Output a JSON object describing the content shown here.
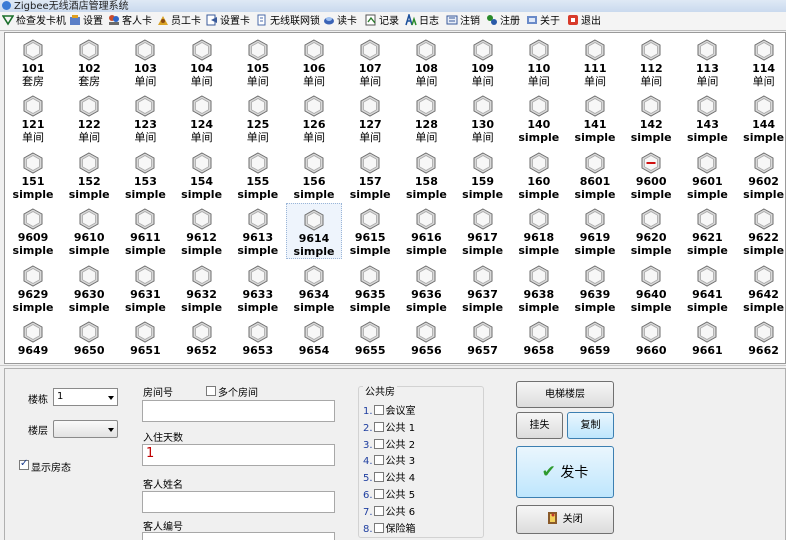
{
  "window": {
    "title": "Zigbee无线酒店管理系统"
  },
  "toolbar": {
    "items": [
      {
        "label": "检查发卡机",
        "icon": "card-check-icon"
      },
      {
        "label": "设置",
        "icon": "settings-icon"
      },
      {
        "label": "客人卡",
        "icon": "guest-card-icon"
      },
      {
        "label": "员工卡",
        "icon": "staff-card-icon"
      },
      {
        "label": "设置卡",
        "icon": "setting-card-icon"
      },
      {
        "label": "无线联网锁",
        "icon": "wireless-lock-icon"
      },
      {
        "label": "读卡",
        "icon": "read-card-icon"
      },
      {
        "label": "记录",
        "icon": "record-icon"
      },
      {
        "label": "日志",
        "icon": "log-icon"
      },
      {
        "label": "注销",
        "icon": "cancel-card-icon"
      },
      {
        "label": "注册",
        "icon": "register-icon"
      },
      {
        "label": "关于",
        "icon": "about-icon"
      },
      {
        "label": "退出",
        "icon": "exit-icon"
      }
    ]
  },
  "rooms": [
    {
      "num": "101",
      "type": "套房"
    },
    {
      "num": "102",
      "type": "套房"
    },
    {
      "num": "103",
      "type": "单间"
    },
    {
      "num": "104",
      "type": "单间"
    },
    {
      "num": "105",
      "type": "单间"
    },
    {
      "num": "106",
      "type": "单间"
    },
    {
      "num": "107",
      "type": "单间"
    },
    {
      "num": "108",
      "type": "单间"
    },
    {
      "num": "109",
      "type": "单间"
    },
    {
      "num": "110",
      "type": "单间"
    },
    {
      "num": "111",
      "type": "单间"
    },
    {
      "num": "112",
      "type": "单间"
    },
    {
      "num": "113",
      "type": "单间"
    },
    {
      "num": "114",
      "type": "单间"
    },
    {
      "num": "121",
      "type": "单间"
    },
    {
      "num": "122",
      "type": "单间"
    },
    {
      "num": "123",
      "type": "单间"
    },
    {
      "num": "124",
      "type": "单间"
    },
    {
      "num": "125",
      "type": "单间"
    },
    {
      "num": "126",
      "type": "单间"
    },
    {
      "num": "127",
      "type": "单间"
    },
    {
      "num": "128",
      "type": "单间"
    },
    {
      "num": "130",
      "type": "单间"
    },
    {
      "num": "140",
      "type": "simple"
    },
    {
      "num": "141",
      "type": "simple"
    },
    {
      "num": "142",
      "type": "simple"
    },
    {
      "num": "143",
      "type": "simple"
    },
    {
      "num": "144",
      "type": "simple"
    },
    {
      "num": "151",
      "type": "simple"
    },
    {
      "num": "152",
      "type": "simple"
    },
    {
      "num": "153",
      "type": "simple"
    },
    {
      "num": "154",
      "type": "simple"
    },
    {
      "num": "155",
      "type": "simple"
    },
    {
      "num": "156",
      "type": "simple"
    },
    {
      "num": "157",
      "type": "simple"
    },
    {
      "num": "158",
      "type": "simple"
    },
    {
      "num": "159",
      "type": "simple"
    },
    {
      "num": "160",
      "type": "simple"
    },
    {
      "num": "8601",
      "type": "simple"
    },
    {
      "num": "9600",
      "type": "simple",
      "status": "occupied"
    },
    {
      "num": "9601",
      "type": "simple"
    },
    {
      "num": "9602",
      "type": "simple"
    },
    {
      "num": "9609",
      "type": "simple"
    },
    {
      "num": "9610",
      "type": "simple"
    },
    {
      "num": "9611",
      "type": "simple"
    },
    {
      "num": "9612",
      "type": "simple"
    },
    {
      "num": "9613",
      "type": "simple"
    },
    {
      "num": "9614",
      "type": "simple",
      "selected": true
    },
    {
      "num": "9615",
      "type": "simple"
    },
    {
      "num": "9616",
      "type": "simple"
    },
    {
      "num": "9617",
      "type": "simple"
    },
    {
      "num": "9618",
      "type": "simple"
    },
    {
      "num": "9619",
      "type": "simple"
    },
    {
      "num": "9620",
      "type": "simple"
    },
    {
      "num": "9621",
      "type": "simple"
    },
    {
      "num": "9622",
      "type": "simple"
    },
    {
      "num": "9629",
      "type": "simple"
    },
    {
      "num": "9630",
      "type": "simple"
    },
    {
      "num": "9631",
      "type": "simple"
    },
    {
      "num": "9632",
      "type": "simple"
    },
    {
      "num": "9633",
      "type": "simple"
    },
    {
      "num": "9634",
      "type": "simple"
    },
    {
      "num": "9635",
      "type": "simple"
    },
    {
      "num": "9636",
      "type": "simple"
    },
    {
      "num": "9637",
      "type": "simple"
    },
    {
      "num": "9638",
      "type": "simple"
    },
    {
      "num": "9639",
      "type": "simple"
    },
    {
      "num": "9640",
      "type": "simple"
    },
    {
      "num": "9641",
      "type": "simple"
    },
    {
      "num": "9642",
      "type": "simple"
    },
    {
      "num": "9649",
      "type": ""
    },
    {
      "num": "9650",
      "type": ""
    },
    {
      "num": "9651",
      "type": ""
    },
    {
      "num": "9652",
      "type": ""
    },
    {
      "num": "9653",
      "type": ""
    },
    {
      "num": "9654",
      "type": ""
    },
    {
      "num": "9655",
      "type": ""
    },
    {
      "num": "9656",
      "type": ""
    },
    {
      "num": "9657",
      "type": ""
    },
    {
      "num": "9658",
      "type": ""
    },
    {
      "num": "9659",
      "type": ""
    },
    {
      "num": "9660",
      "type": ""
    },
    {
      "num": "9661",
      "type": ""
    },
    {
      "num": "9662",
      "type": ""
    }
  ],
  "form": {
    "building_label": "楼栋",
    "building_value": "1",
    "floor_label": "楼层",
    "floor_value": "",
    "show_status_label": "显示房态",
    "show_status_checked": true,
    "room_no_label": "房间号",
    "multi_room_label": "多个房间",
    "room_no_value": "",
    "days_label": "入住天数",
    "days_value": "1",
    "guest_name_label": "客人姓名",
    "guest_name_value": "",
    "guest_id_label": "客人编号",
    "guest_id_value": ""
  },
  "public_rooms": {
    "title": "公共房",
    "items": [
      {
        "n": "1.",
        "label": "会议室"
      },
      {
        "n": "2.",
        "label": "公共 1"
      },
      {
        "n": "3.",
        "label": "公共 2"
      },
      {
        "n": "4.",
        "label": "公共 3"
      },
      {
        "n": "5.",
        "label": "公共 4"
      },
      {
        "n": "6.",
        "label": "公共 5"
      },
      {
        "n": "7.",
        "label": "公共 6"
      },
      {
        "n": "8.",
        "label": "保险箱"
      }
    ]
  },
  "actions": {
    "elevator_label": "电梯楼层",
    "report_loss_label": "挂失",
    "copy_label": "复制",
    "issue_label": "发卡",
    "close_label": "关闭"
  },
  "colors": {
    "accent_blue": "#3c7fb1",
    "issue_check_green": "#2e9a2e",
    "occupied_red": "#d01010"
  }
}
